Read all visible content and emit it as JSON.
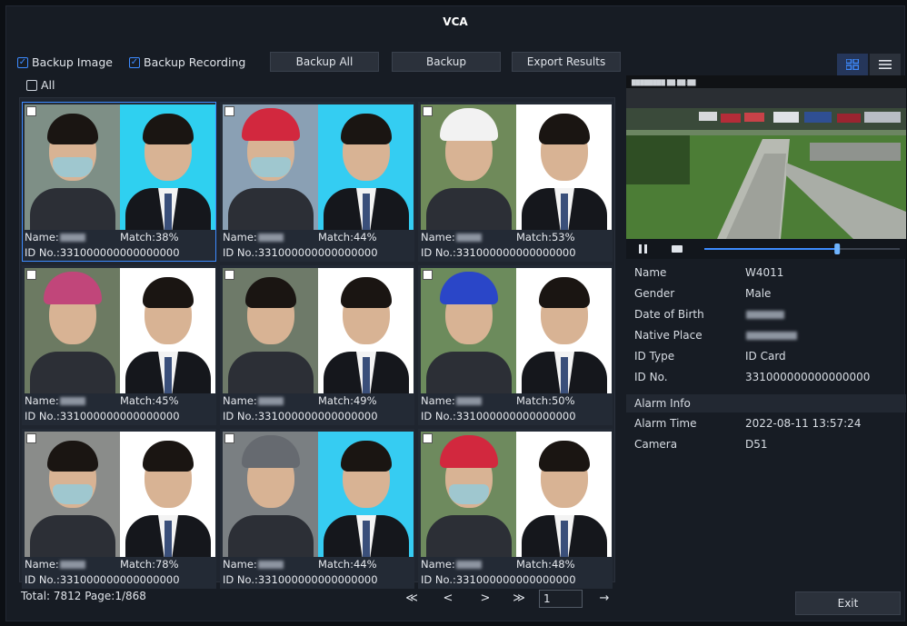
{
  "title": "VCA",
  "toolbar": {
    "backup_image_label": "Backup Image",
    "backup_image_checked": true,
    "backup_recording_label": "Backup Recording",
    "backup_recording_checked": true,
    "backup_all_label": "Backup All",
    "backup_label": "Backup",
    "export_label": "Export Results",
    "view_grid_icon": "grid-view-icon",
    "view_list_icon": "list-view-icon"
  },
  "select_all_label": "All",
  "results": [
    {
      "name_prefix": "Name:",
      "match": "Match:38%",
      "id": "ID No.:331000000000000000",
      "selected": true,
      "helmet": "",
      "mask": true,
      "snap_bg": "#7e8f86",
      "reg_bg": "#2fd0f0"
    },
    {
      "name_prefix": "Name:",
      "match": "Match:44%",
      "id": "ID No.:331000000000000000",
      "selected": false,
      "helmet": "#d2283e",
      "mask": true,
      "snap_bg": "#8aa0b4",
      "reg_bg": "#34cdf2"
    },
    {
      "name_prefix": "Name:",
      "match": "Match:53%",
      "id": "ID No.:331000000000000000",
      "selected": false,
      "helmet": "#f2f2f2",
      "mask": false,
      "snap_bg": "#6f8a5a",
      "reg_bg": "#ffffff"
    },
    {
      "name_prefix": "Name:",
      "match": "Match:45%",
      "id": "ID No.:331000000000000000",
      "selected": false,
      "helmet": "#c1467a",
      "mask": false,
      "snap_bg": "#6c7a62",
      "reg_bg": "#ffffff"
    },
    {
      "name_prefix": "Name:",
      "match": "Match:49%",
      "id": "ID No.:331000000000000000",
      "selected": false,
      "helmet": "",
      "mask": false,
      "snap_bg": "#6e7a69",
      "reg_bg": "#ffffff"
    },
    {
      "name_prefix": "Name:",
      "match": "Match:50%",
      "id": "ID No.:331000000000000000",
      "selected": false,
      "helmet": "#2a46c8",
      "mask": false,
      "snap_bg": "#6c8b5c",
      "reg_bg": "#ffffff"
    },
    {
      "name_prefix": "Name:",
      "match": "Match:78%",
      "id": "ID No.:331000000000000000",
      "selected": false,
      "helmet": "",
      "mask": true,
      "snap_bg": "#8a8c8a",
      "reg_bg": "#ffffff"
    },
    {
      "name_prefix": "Name:",
      "match": "Match:44%",
      "id": "ID No.:331000000000000000",
      "selected": false,
      "helmet": "#666a70",
      "mask": false,
      "snap_bg": "#7a7f82",
      "reg_bg": "#36ccf2"
    },
    {
      "name_prefix": "Name:",
      "match": "Match:48%",
      "id": "ID No.:331000000000000000",
      "selected": false,
      "helmet": "#d2283e",
      "mask": true,
      "snap_bg": "#6e8a5e",
      "reg_bg": "#ffffff"
    }
  ],
  "footer": {
    "total": "Total: 7812  Page:1/868",
    "first": "≪",
    "prev": "<",
    "next": ">",
    "last": "≫",
    "page_value": "1",
    "go": "→"
  },
  "details": {
    "name_label": "Name",
    "name_value": "W4011",
    "gender_label": "Gender",
    "gender_value": "Male",
    "dob_label": "Date of Birth",
    "native_label": "Native Place",
    "idtype_label": "ID Type",
    "idtype_value": "ID Card",
    "idno_label": "ID No.",
    "idno_value": "331000000000000000"
  },
  "alarm": {
    "section_label": "Alarm Info",
    "time_label": "Alarm Time",
    "time_value": "2022-08-11 13:57:24",
    "camera_label": "Camera",
    "camera_value": "D51"
  },
  "playback": {
    "progress": 0.68
  },
  "exit_label": "Exit",
  "colors": {
    "accent": "#3d8bff",
    "panel": "#171c24"
  }
}
